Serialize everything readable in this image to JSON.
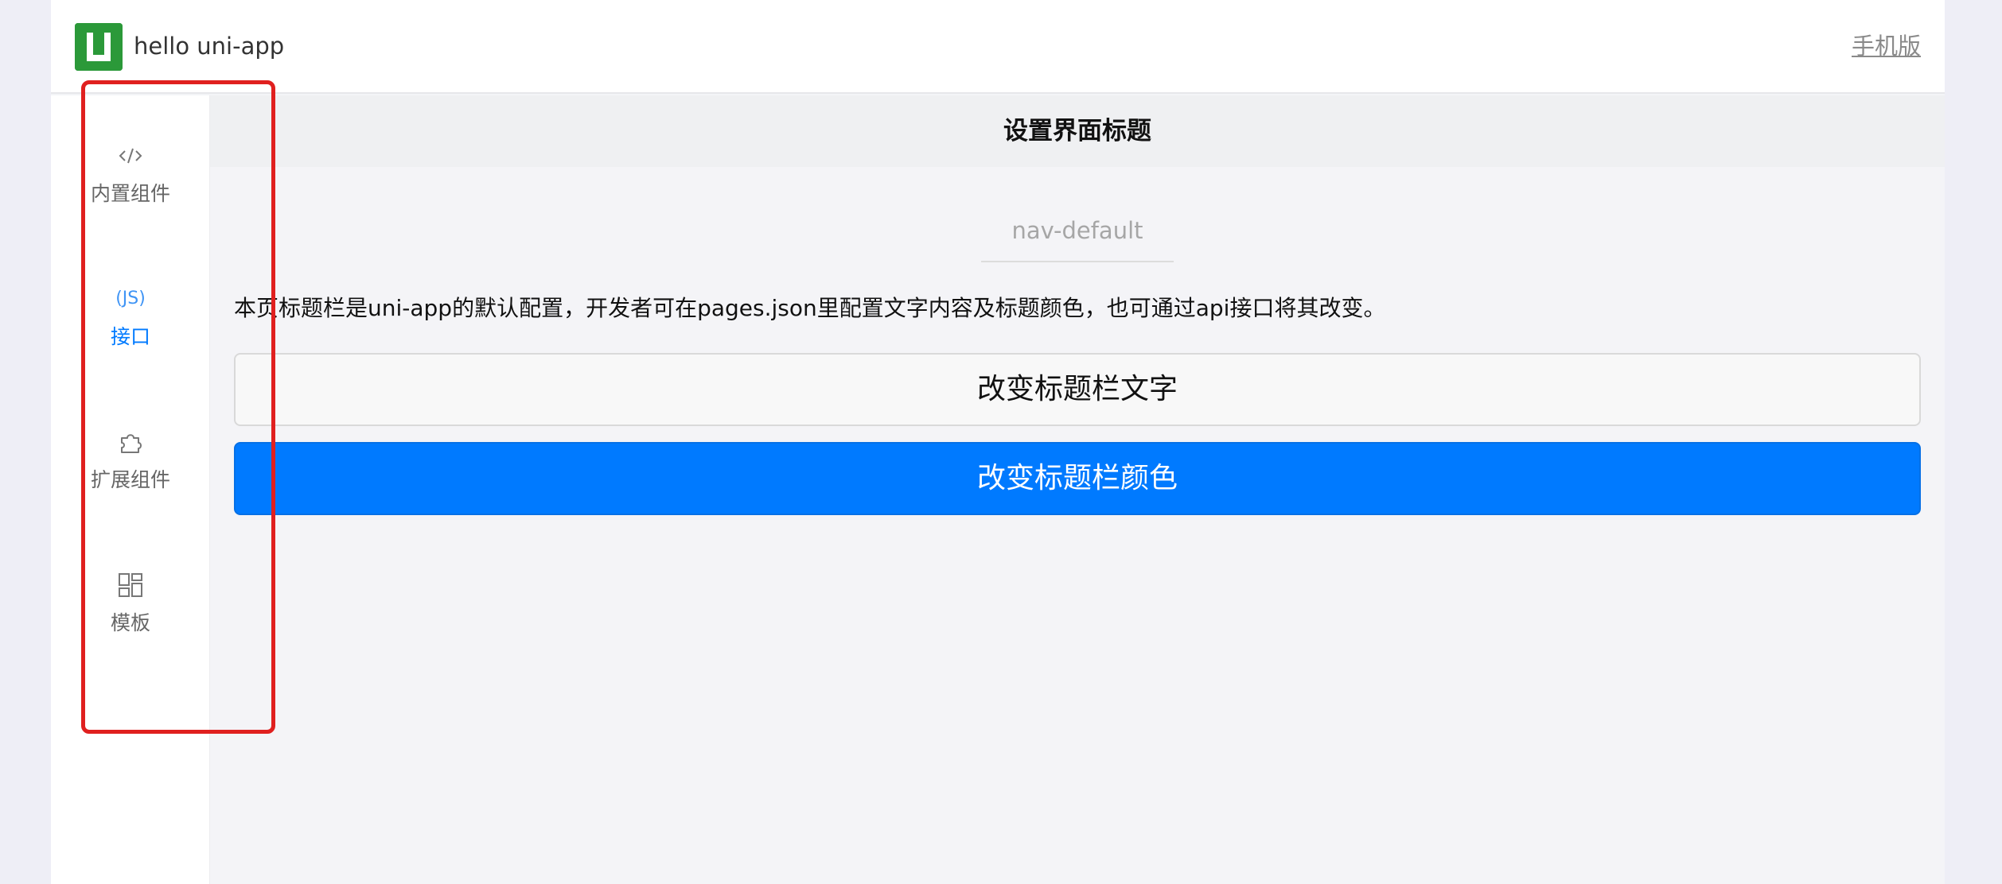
{
  "header": {
    "app_title": "hello uni-app",
    "mobile_link": "手机版",
    "logo_color": "#2b9939"
  },
  "sidebar": {
    "items": [
      {
        "icon": "code-icon",
        "icon_text": "</>",
        "label": "内置组件",
        "active": false
      },
      {
        "icon": "js-icon",
        "icon_text": "(JS)",
        "label": "接口",
        "active": true
      },
      {
        "icon": "puzzle-icon",
        "icon_text": "",
        "label": "扩展组件",
        "active": false
      },
      {
        "icon": "template-icon",
        "icon_text": "",
        "label": "模板",
        "active": false
      }
    ],
    "active_color": "#007aff",
    "highlight_color": "#e0201f"
  },
  "page": {
    "nav_title": "设置界面标题",
    "nav_default_label": "nav-default",
    "description": "本页标题栏是uni-app的默认配置，开发者可在pages.json里配置文字内容及标题颜色，也可通过api接口将其改变。",
    "buttons": {
      "change_text": "改变标题栏文字",
      "change_color": "改变标题栏颜色"
    },
    "primary_color": "#007aff"
  }
}
